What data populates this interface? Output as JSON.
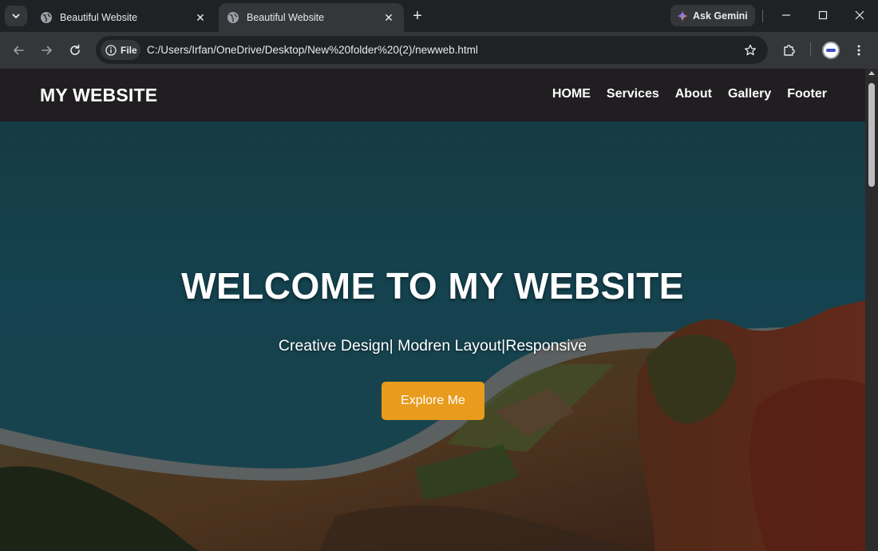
{
  "browser": {
    "tabs": [
      {
        "title": "Beautiful Website",
        "active": false
      },
      {
        "title": "Beautiful Website",
        "active": true
      }
    ],
    "new_tab_icon": "+",
    "gemini_label": "Ask Gemini",
    "site_chip_label": "File",
    "url": "C:/Users/Irfan/OneDrive/Desktop/New%20folder%20(2)/newweb.html",
    "colors": {
      "tabstrip_bg": "#202124",
      "toolbar_bg": "#35363a",
      "omnibox_bg": "#202124",
      "text": "#e8eaed"
    }
  },
  "site": {
    "logo": "MY WEBSITE",
    "nav": [
      "HOME",
      "Services",
      "About",
      "Gallery",
      "Footer"
    ],
    "hero": {
      "title": "WELCOME TO MY WEBSITE",
      "subtitle": "Creative Design| Modren Layout|Responsive",
      "cta_label": "Explore Me"
    },
    "colors": {
      "nav_bg": "#201e20",
      "cta_bg": "#e89b1c",
      "text": "#ffffff"
    }
  }
}
